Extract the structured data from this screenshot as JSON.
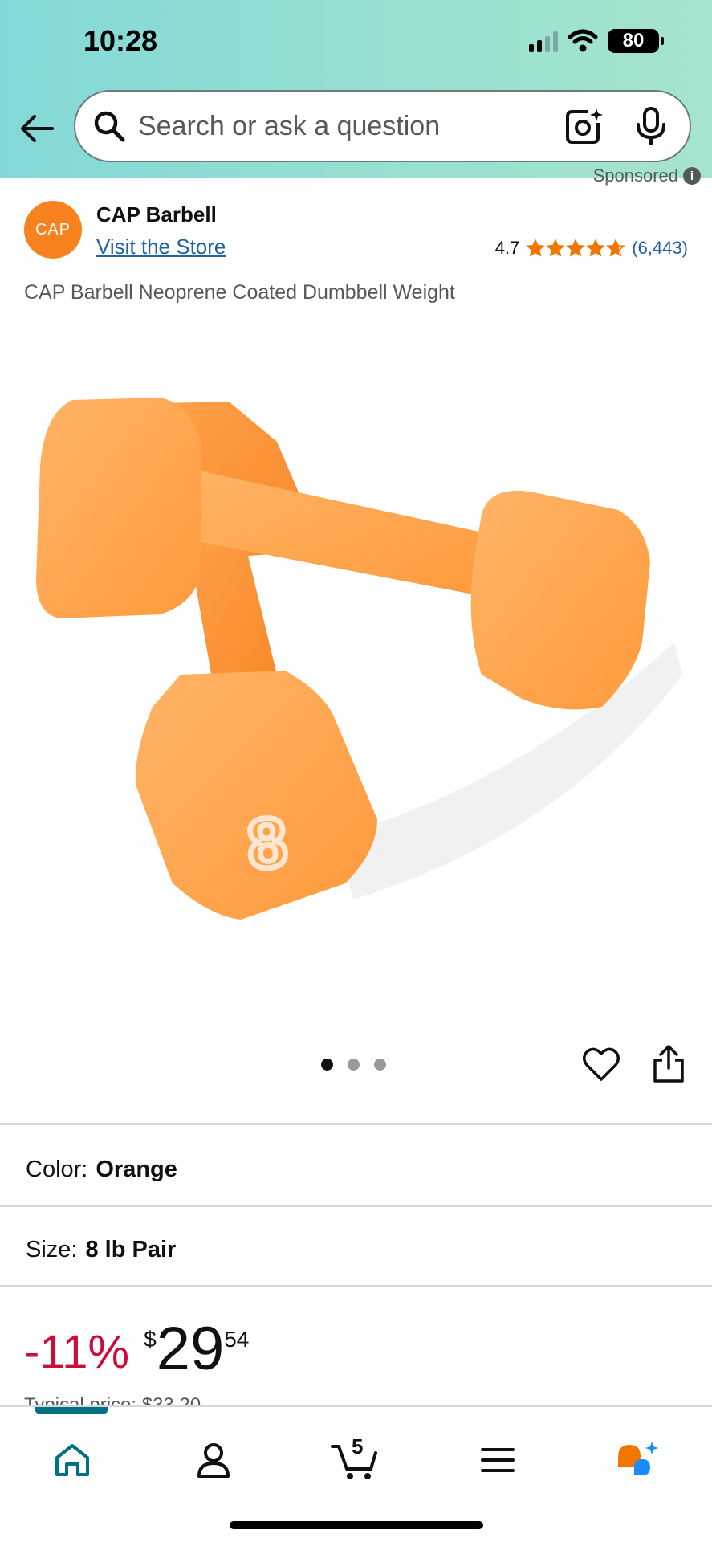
{
  "status": {
    "time": "10:28",
    "battery": "80"
  },
  "search": {
    "placeholder": "Search or ask a question"
  },
  "sponsored_label": "Sponsored",
  "brand": {
    "logo_text": "CAP",
    "name": "CAP Barbell",
    "visit_store": "Visit the Store"
  },
  "rating": {
    "value": "4.7",
    "stars": 4.7,
    "count": "(6,443)"
  },
  "product": {
    "title": "CAP Barbell Neoprene Coated Dumbbell Weight",
    "image_weight_label": "8"
  },
  "carousel": {
    "total": 3,
    "active": 1
  },
  "variations": {
    "color": {
      "label": "Color:",
      "value": "Orange"
    },
    "size": {
      "label": "Size:",
      "value": "8 lb Pair"
    }
  },
  "price": {
    "discount": "-11%",
    "currency": "$",
    "whole": "29",
    "fraction": "54",
    "typical": "Typical price: $33.20"
  },
  "tabbar": {
    "cart_count": "5"
  },
  "colors": {
    "accent": "#007185",
    "star": "#f27500",
    "discount": "#cc0c39",
    "link": "#2162a1",
    "product": "#ff9f45"
  },
  "icons": [
    "back-arrow-icon",
    "search-icon",
    "camera-lens-icon",
    "microphone-icon",
    "info-icon",
    "heart-icon",
    "share-icon",
    "home-icon",
    "account-icon",
    "cart-icon",
    "menu-icon",
    "rufus-icon"
  ]
}
